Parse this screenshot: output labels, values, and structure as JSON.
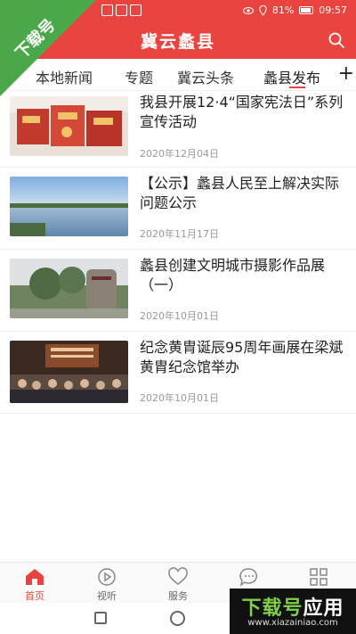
{
  "status_bar": {
    "battery": "81%",
    "time": "09:57"
  },
  "header": {
    "title": "冀云蠡县"
  },
  "watermark": {
    "corner_text": "下载号",
    "bottom_text_1": "下载号",
    "bottom_text_2": "应用",
    "bottom_url": "www.xiazainiao.com"
  },
  "tabs": [
    {
      "label": "本地新闻"
    },
    {
      "label": "专题"
    },
    {
      "label": "冀云头条"
    },
    {
      "label": "蠡县发布"
    }
  ],
  "tab_add": "+",
  "news": [
    {
      "title": "我县开展12·4“国家宪法日”系列宣传活动",
      "date": "2020年12月04日"
    },
    {
      "title": "【公示】蠡县人民至上解决实际问题公示",
      "date": "2020年11月17日"
    },
    {
      "title": "蠡县创建文明城市摄影作品展（一）",
      "date": "2020年10月01日"
    },
    {
      "title": "纪念黄胄诞辰95周年画展在梁斌黄胄纪念馆举办",
      "date": "2020年10月01日"
    }
  ],
  "bottom_nav": [
    {
      "label": "首页"
    },
    {
      "label": "视听"
    },
    {
      "label": "服务"
    },
    {
      "label": ""
    },
    {
      "label": ""
    }
  ],
  "colors": {
    "brand_red": "#e9443f",
    "watermark_green": "#4aa84a"
  }
}
